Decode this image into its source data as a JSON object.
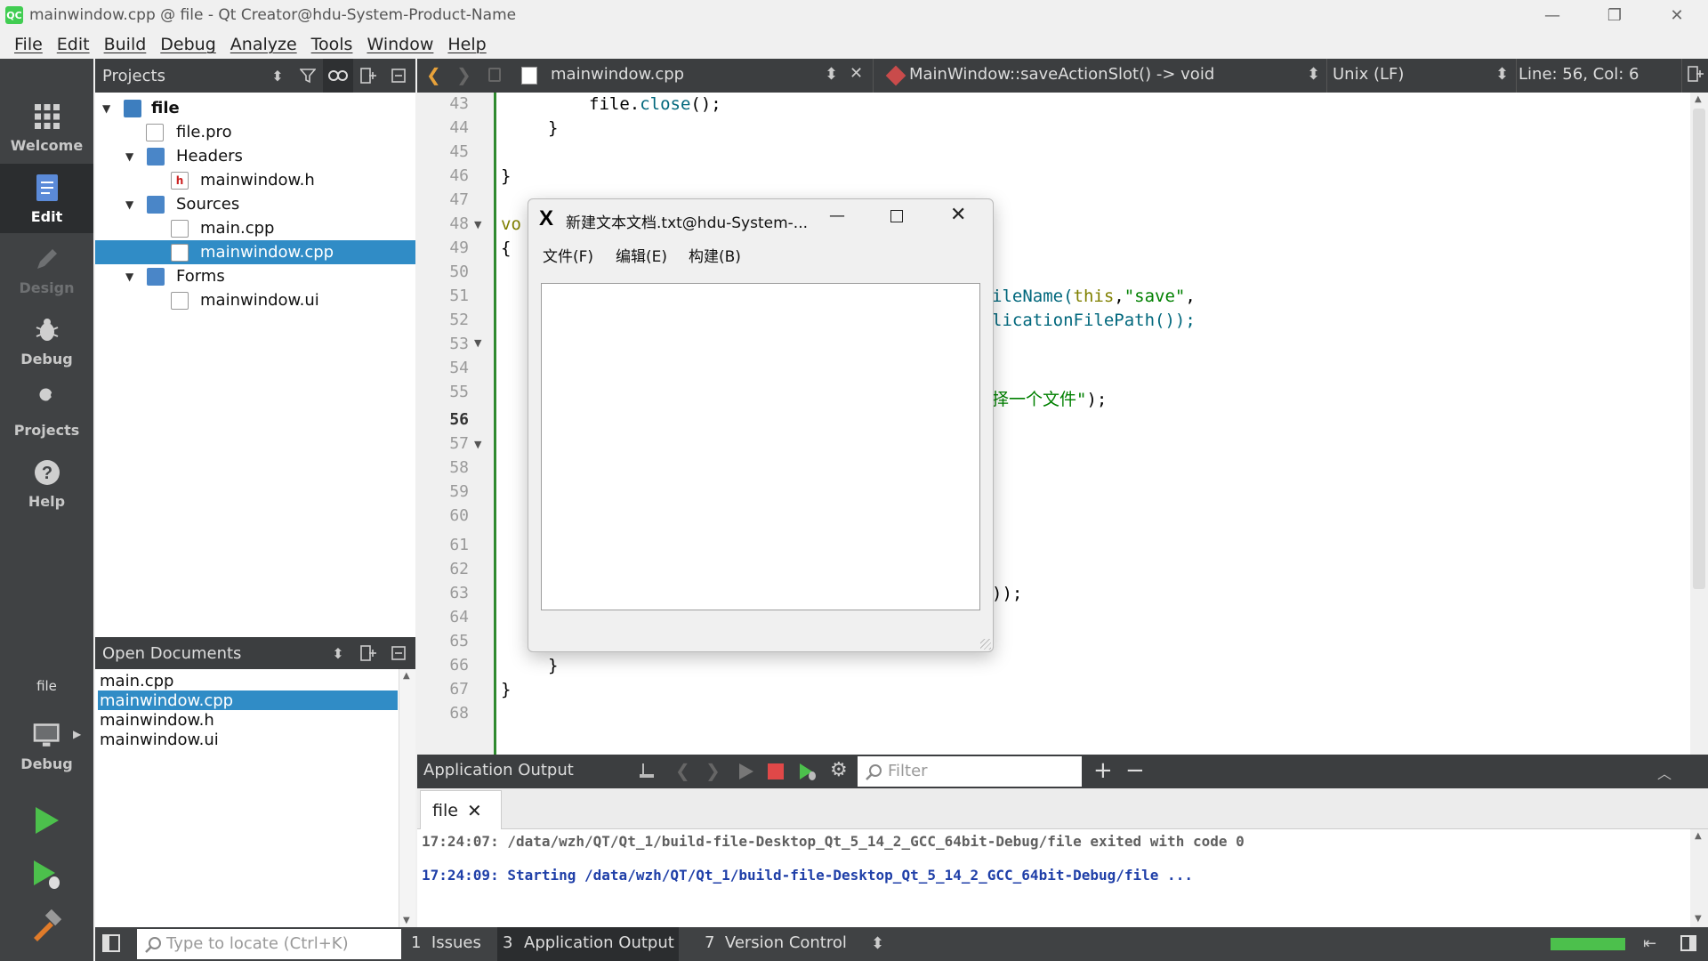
{
  "window": {
    "title": "mainwindow.cpp @ file - Qt Creator@hdu-System-Product-Name",
    "logo": "QC",
    "minimize": "—",
    "restore": "❐",
    "close": "✕"
  },
  "menubar": [
    "File",
    "Edit",
    "Build",
    "Debug",
    "Analyze",
    "Tools",
    "Window",
    "Help"
  ],
  "modes": {
    "welcome": "Welcome",
    "edit": "Edit",
    "design": "Design",
    "debug": "Debug",
    "projects": "Projects",
    "help": "Help",
    "kit_project": "file",
    "kit_config": "Debug"
  },
  "projects": {
    "header": "Projects",
    "tree": [
      {
        "label": "file",
        "level": 0,
        "kind": "project",
        "expanded": true
      },
      {
        "label": "file.pro",
        "level": 1,
        "kind": "pro"
      },
      {
        "label": "Headers",
        "level": 1,
        "kind": "folder",
        "expanded": true
      },
      {
        "label": "mainwindow.h",
        "level": 2,
        "kind": "h"
      },
      {
        "label": "Sources",
        "level": 1,
        "kind": "folder",
        "expanded": true
      },
      {
        "label": "main.cpp",
        "level": 2,
        "kind": "cpp"
      },
      {
        "label": "mainwindow.cpp",
        "level": 2,
        "kind": "cpp",
        "selected": true
      },
      {
        "label": "Forms",
        "level": 1,
        "kind": "folder",
        "expanded": true
      },
      {
        "label": "mainwindow.ui",
        "level": 2,
        "kind": "ui"
      }
    ]
  },
  "open_documents": {
    "header": "Open Documents",
    "items": [
      "main.cpp",
      "mainwindow.cpp",
      "mainwindow.h",
      "mainwindow.ui"
    ],
    "selected_index": 1
  },
  "editor": {
    "file": "mainwindow.cpp",
    "symbol": "MainWindow::saveActionSlot() -> void",
    "line_ending": "Unix (LF)",
    "position": "Line: 56, Col: 6",
    "current_line": "56",
    "line_numbers": [
      "43",
      "44",
      "45",
      "46",
      "47",
      "48",
      "49",
      "50",
      "51",
      "52",
      "53",
      "54",
      "55",
      "56",
      "57",
      "58",
      "59",
      "60",
      "61",
      "62",
      "63",
      "64",
      "65",
      "66",
      "67",
      "68"
    ],
    "code": {
      "l43_a": "file.",
      "l43_b": "close",
      "l43_c": "();",
      "l44": "}",
      "l46": "}",
      "l48": "vo",
      "l49": "{",
      "l51_a": "ileName(",
      "l51_b": "this",
      "l51_c": ",",
      "l51_d": "\"save\"",
      "l51_e": ",",
      "l52": "licationFilePath());",
      "l55_a": "择一个文件\"",
      "l55_b": ");",
      "l63": "));",
      "l66": "}",
      "l67": "}"
    }
  },
  "dialog": {
    "title": "新建文本文档.txt@hdu-System-...",
    "menus": [
      "文件(F)",
      "编辑(E)",
      "构建(B)"
    ]
  },
  "output": {
    "title": "Application Output",
    "filter_placeholder": "Filter",
    "tab": "file",
    "lines": [
      {
        "text": "17:24:07: /data/wzh/QT/Qt_1/build-file-Desktop_Qt_5_14_2_GCC_64bit-Debug/file exited with code 0",
        "color": "#606060"
      },
      {
        "text": "17:24:09: Starting /data/wzh/QT/Qt_1/build-file-Desktop_Qt_5_14_2_GCC_64bit-Debug/file ...",
        "color": "#1f3fa8"
      }
    ]
  },
  "statusbar": {
    "locate_placeholder": "Type to locate (Ctrl+K)",
    "tabs": [
      {
        "num": "1",
        "label": "Issues"
      },
      {
        "num": "3",
        "label": "Application Output"
      },
      {
        "num": "7",
        "label": "Version Control"
      }
    ]
  },
  "colors": {
    "accent": "#308cc6",
    "dark_panel": "#404244",
    "build_progress": "#4cc04c"
  }
}
